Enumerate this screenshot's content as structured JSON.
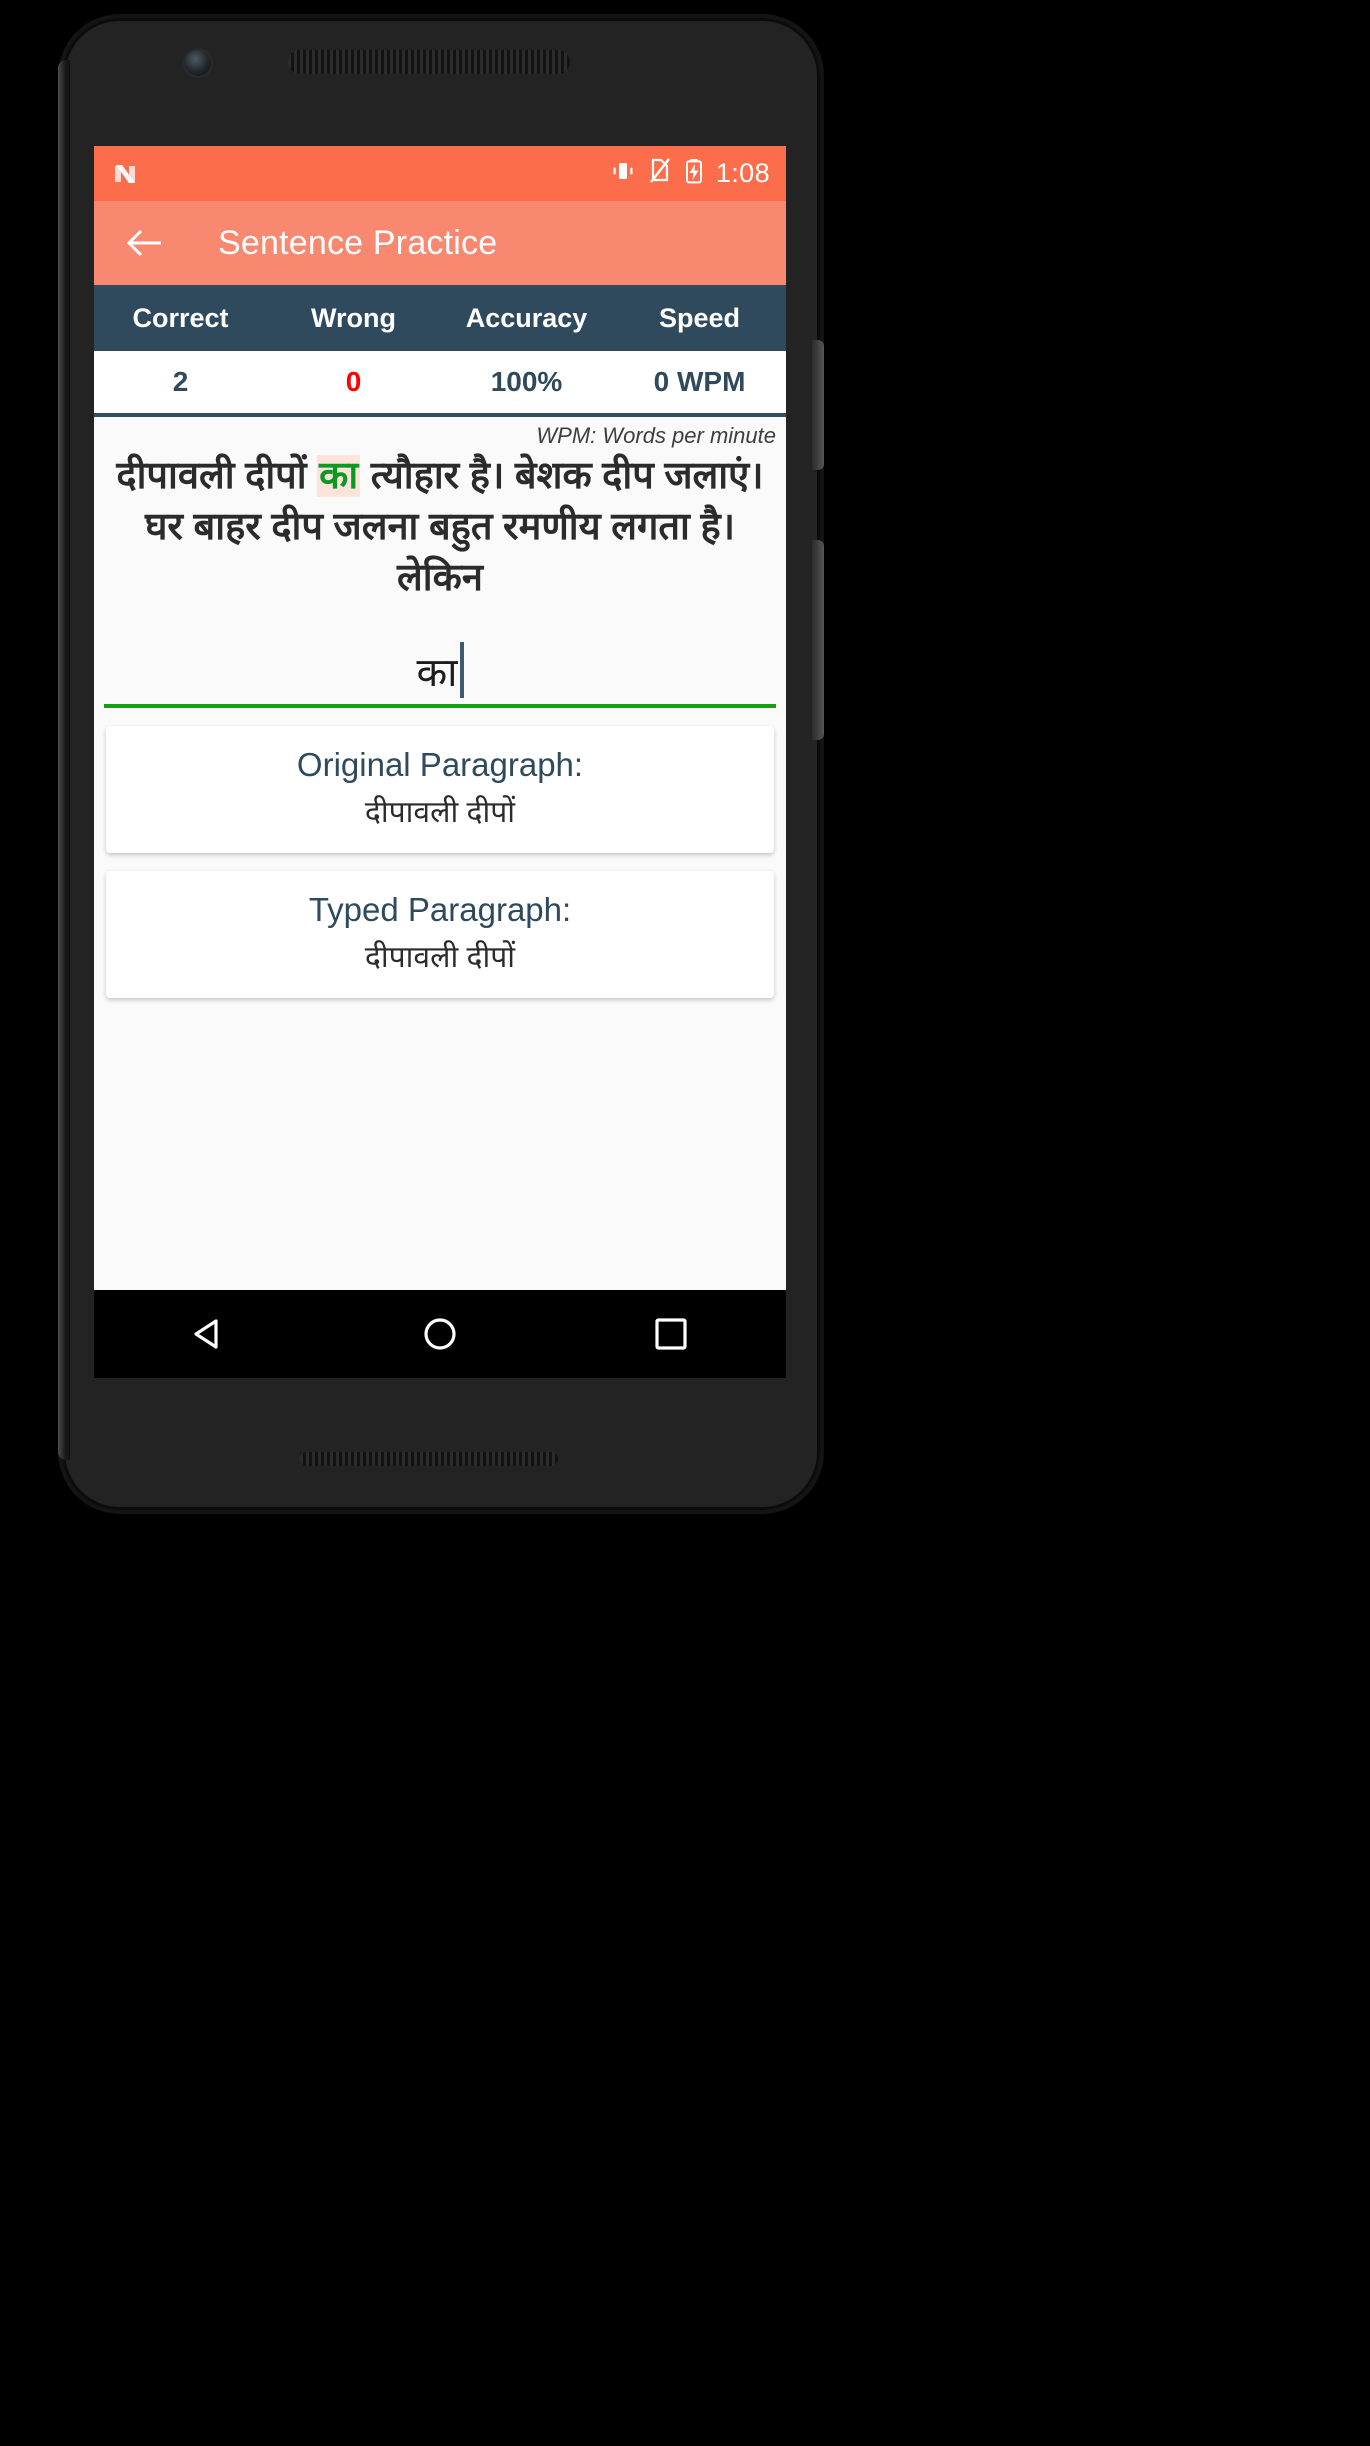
{
  "status_bar": {
    "logo_icon": "android-n-logo-icon",
    "icons": [
      "vibrate-icon",
      "no-sim-icon",
      "battery-charging-icon"
    ],
    "time": "1:08",
    "bg_color": "#fc6e4b"
  },
  "toolbar": {
    "back_icon": "back-arrow-icon",
    "title": "Sentence Practice",
    "bg_color": "#f98870"
  },
  "stats": {
    "headers": [
      "Correct",
      "Wrong",
      "Accuracy",
      "Speed"
    ],
    "values": [
      "2",
      "0",
      "100%",
      "0 WPM"
    ],
    "header_bg": "#2f4a5c",
    "wrong_color": "#ff0000",
    "value_color": "#2f4a5c"
  },
  "note": {
    "wpm_legend": "WPM: Words per minute"
  },
  "paragraph": {
    "before": "दीपावली दीपों ",
    "highlight": "का",
    "after": " त्यौहार है। बेशक दीप जलाएं। घर बाहर दीप जलना बहुत रमणीय लगता है। लेकिन",
    "highlight_bg": "#fde3da",
    "highlight_color": "#0a9a22"
  },
  "typing": {
    "value": "का",
    "placeholder": "",
    "underline_color": "#13a013",
    "caret_color": "#3c5a70"
  },
  "cards": [
    {
      "title": "Original Paragraph:",
      "text": "दीपावली दीपों"
    },
    {
      "title": "Typed Paragraph:",
      "text": "दीपावली दीपों"
    }
  ],
  "nav_bar": {
    "buttons": [
      "back-triangle-icon",
      "home-circle-icon",
      "recents-square-icon"
    ]
  }
}
